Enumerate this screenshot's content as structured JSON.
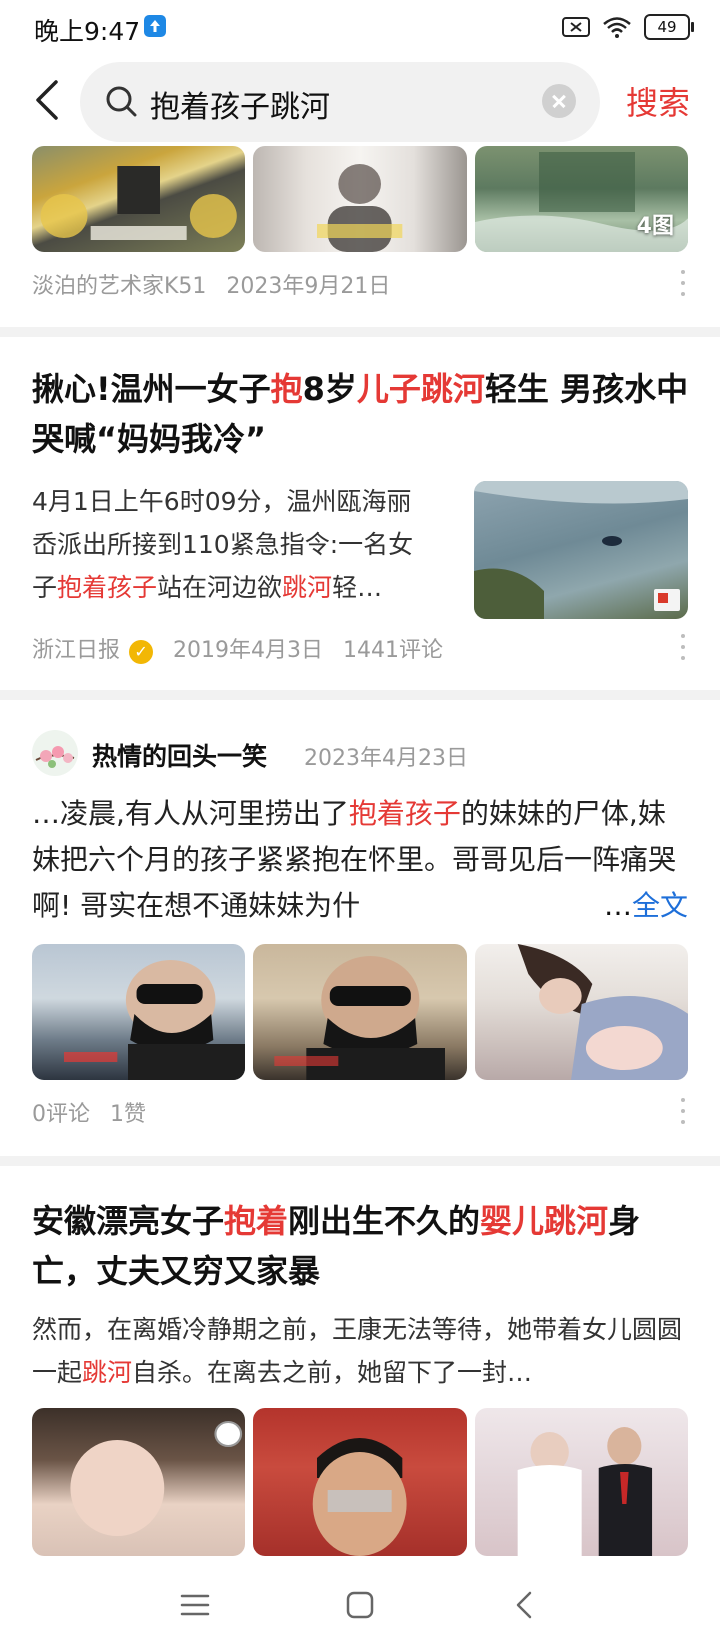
{
  "status_bar": {
    "time": "晚上9:47",
    "battery": "49"
  },
  "search": {
    "query": "抱着孩子跳河",
    "action_label": "搜索"
  },
  "result1": {
    "author": "淡泊的艺术家K51",
    "date": "2023年9月21日",
    "image_count": "4图"
  },
  "result2": {
    "title_parts": [
      "揪心!温州一女子",
      "抱",
      "8岁",
      "儿子跳河",
      "轻生 男孩水中哭喊“妈妈我冷”"
    ],
    "snippet_parts": [
      "4月1日上午6时09分，温州瓯海丽岙派出所接到110紧急指令:一名女子",
      "抱着孩子",
      "站在河边欲",
      "跳河",
      "轻…"
    ],
    "source": "浙江日报",
    "date": "2019年4月3日",
    "comments": "1441评论"
  },
  "result3": {
    "author": "热情的回头一笑",
    "date": "2023年4月23日",
    "snippet_parts": [
      "…凌晨,有人从河里捞出了",
      "抱着孩子",
      "的妹妹的尸体,妹妹把六个月的孩子紧紧抱在怀里。哥哥见后一阵痛哭啊! 哥实在想不通妹妹为什"
    ],
    "more": "…",
    "fulltext": "全文",
    "comments": "0评论",
    "likes": "1赞"
  },
  "result4": {
    "title_parts": [
      "安徽漂亮女子",
      "抱着",
      "刚出生不久的",
      "婴儿跳河",
      "身亡，丈夫又穷又家暴"
    ],
    "snippet_parts": [
      "然而，在离婚冷静期之前，王康无法等待，她带着女儿圆圆一起",
      "跳河",
      "自杀。在离去之前，她留下了一封…"
    ]
  },
  "colors": {
    "highlight": "#e53935",
    "link": "#1e6fd9",
    "meta": "#9a9a9a"
  }
}
